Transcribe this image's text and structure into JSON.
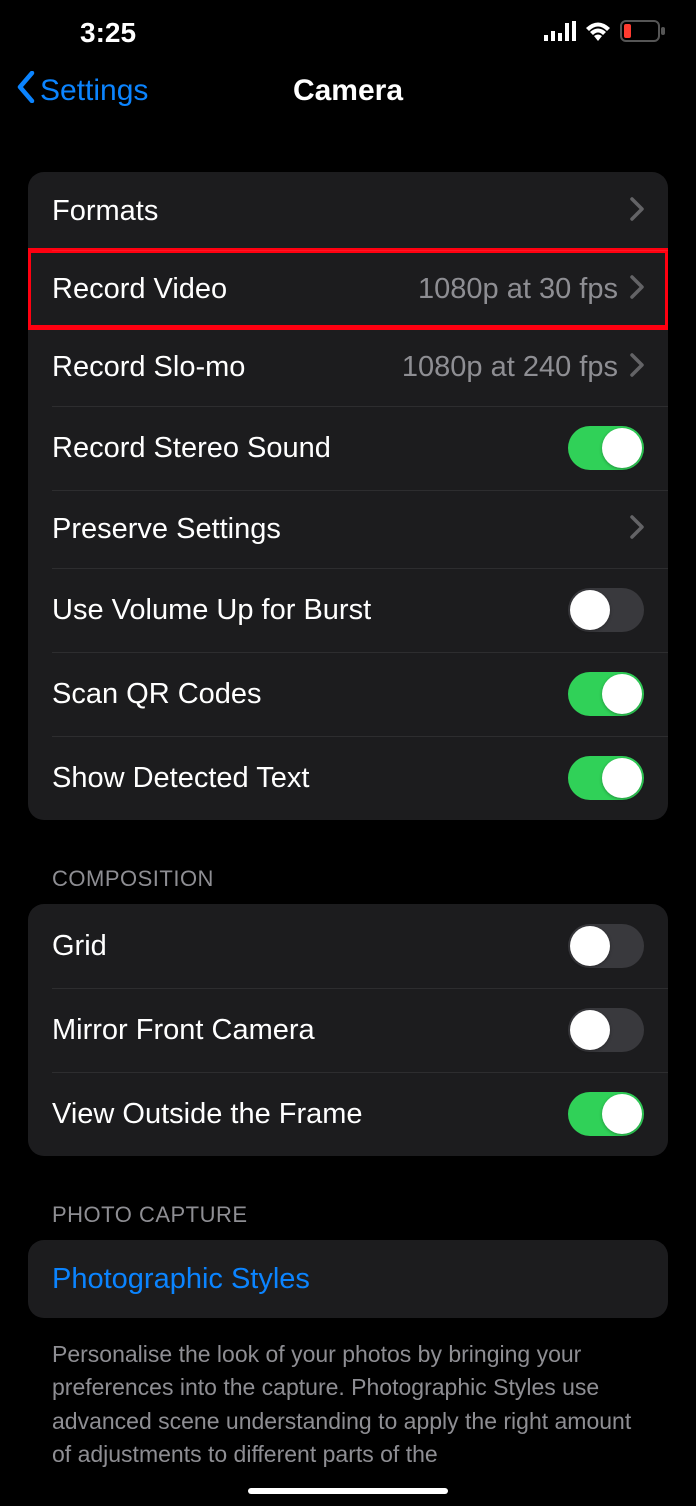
{
  "status": {
    "time": "3:25"
  },
  "nav": {
    "back_label": "Settings",
    "title": "Camera"
  },
  "group1": {
    "formats": "Formats",
    "record_video": "Record Video",
    "record_video_value": "1080p at 30 fps",
    "record_slomo": "Record Slo-mo",
    "record_slomo_value": "1080p at 240 fps",
    "stereo_sound": "Record Stereo Sound",
    "preserve": "Preserve Settings",
    "volume_burst": "Use Volume Up for Burst",
    "scan_qr": "Scan QR Codes",
    "detected_text": "Show Detected Text"
  },
  "section_composition": "Composition",
  "group2": {
    "grid": "Grid",
    "mirror": "Mirror Front Camera",
    "view_outside": "View Outside the Frame"
  },
  "section_photo_capture": "Photo Capture",
  "group3": {
    "styles": "Photographic Styles"
  },
  "footer": "Personalise the look of your photos by bringing your preferences into the capture. Photographic Styles use advanced scene understanding to apply the right amount of adjustments to different parts of the"
}
